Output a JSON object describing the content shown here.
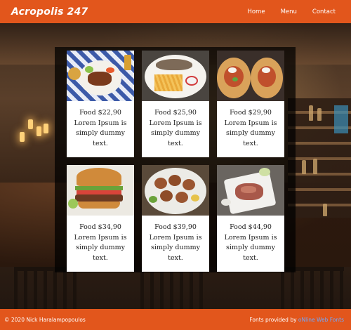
{
  "header": {
    "logo": "Acropolis 247",
    "nav": [
      "Home",
      "Menu",
      "Contact"
    ]
  },
  "menu_items": [
    {
      "title": "Food $22,90",
      "desc1": "Lorem Ipsum is",
      "desc2": "simply dummy",
      "desc3": "text."
    },
    {
      "title": "Food $25,90",
      "desc1": "Lorem Ipsum is",
      "desc2": "simply dummy",
      "desc3": "text."
    },
    {
      "title": "Food $29,90",
      "desc1": "Lorem Ipsum is",
      "desc2": "simply dummy",
      "desc3": "text."
    },
    {
      "title": "Food $34,90",
      "desc1": "Lorem Ipsum is",
      "desc2": "simply dummy",
      "desc3": "text."
    },
    {
      "title": "Food $39,90",
      "desc1": "Lorem Ipsum is",
      "desc2": "simply dummy",
      "desc3": "text."
    },
    {
      "title": "Food $44,90",
      "desc1": "Lorem Ipsum is",
      "desc2": "simply dummy",
      "desc3": "text."
    }
  ],
  "footer": {
    "copyright": "© 2020 Nick Haralampopoulos",
    "fonts_prefix": "Fonts provided by ",
    "fonts_link": "oNline Web Fonts"
  },
  "colors": {
    "brand": "#e2561c",
    "link": "#6fa8ff"
  }
}
